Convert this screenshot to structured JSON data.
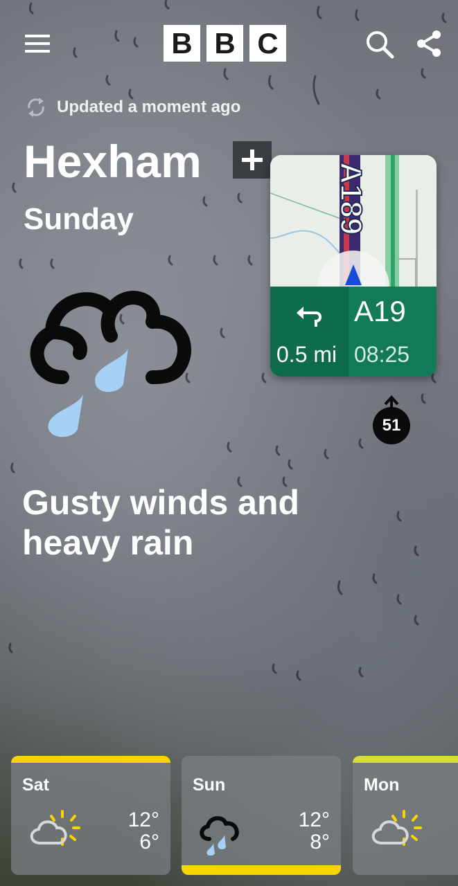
{
  "header": {
    "menu_icon": "hamburger-menu-icon",
    "logo_letters": [
      "B",
      "B",
      "C"
    ],
    "search_icon": "search-icon",
    "share_icon": "share-icon"
  },
  "status": {
    "updated_label": "Updated a moment ago",
    "icon": "refresh-icon"
  },
  "location": {
    "name": "Hexham",
    "add_icon": "plus-icon"
  },
  "current": {
    "day": "Sunday",
    "icon": "rain-cloud-icon",
    "summary": "Gusty winds and heavy rain"
  },
  "navigation_overlay": {
    "map_road_label": "A189",
    "turn_icon": "turn-left-arrow-icon",
    "road": "A19",
    "distance": "0.5 mi",
    "eta": "08:25",
    "badge": "51",
    "colors": {
      "panel": "#0f6b4e",
      "panel_right": "#137a59"
    }
  },
  "forecast": [
    {
      "day": "Sat",
      "icon": "sunny-intervals-icon",
      "high": "12°",
      "low": "6°",
      "selected": false
    },
    {
      "day": "Sun",
      "icon": "heavy-rain-icon",
      "high": "12°",
      "low": "8°",
      "selected": true
    },
    {
      "day": "Mon",
      "icon": "sunny-intervals-icon",
      "high": "",
      "low": "",
      "selected": false
    }
  ],
  "colors": {
    "accent": "#f8d501",
    "rain_drop": "#a6d0f4"
  }
}
